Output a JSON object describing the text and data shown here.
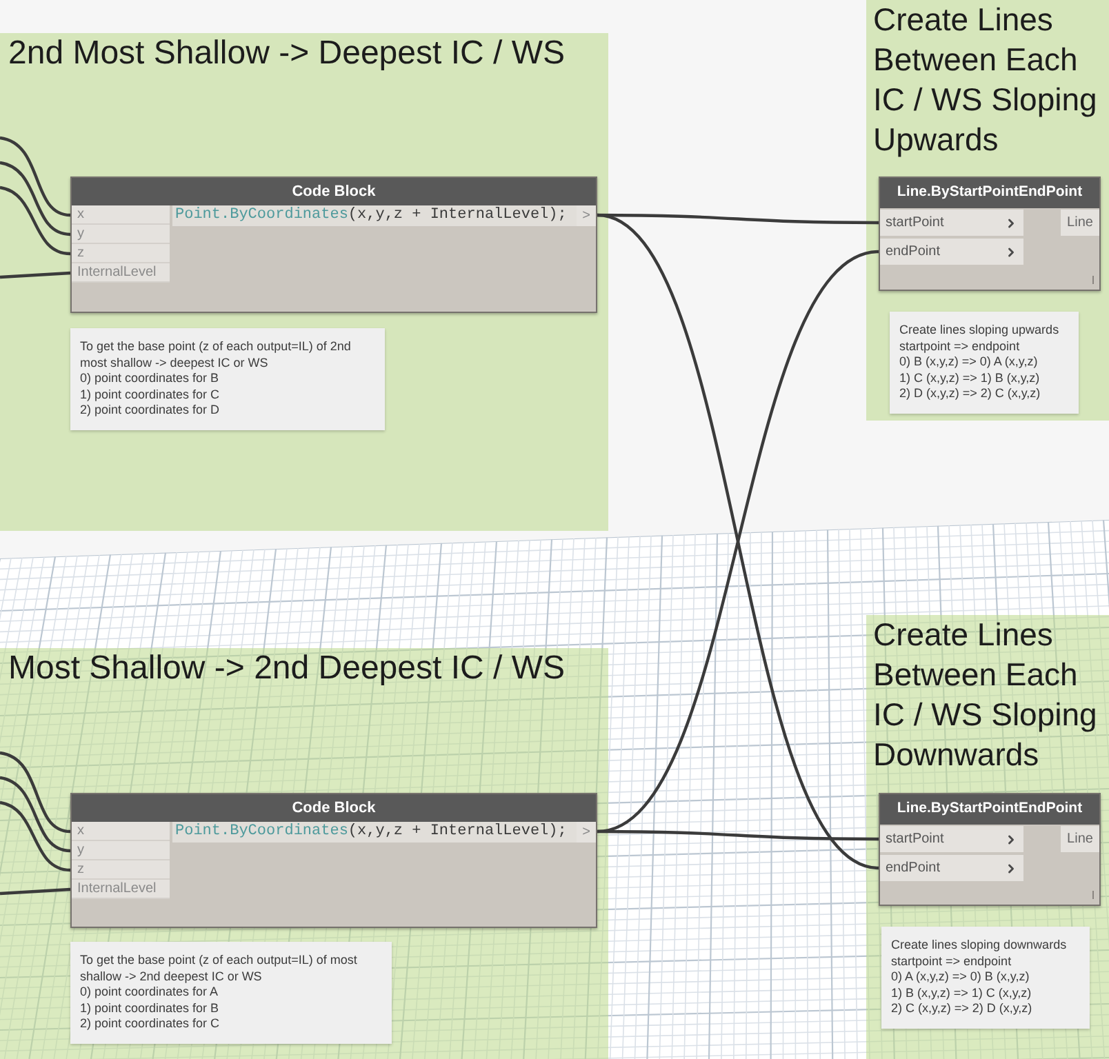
{
  "groups": [
    {
      "title": "2nd Most Shallow -> Deepest IC / WS",
      "node": {
        "kind": "code_block",
        "title": "Code Block",
        "inputs": [
          "x",
          "y",
          "z",
          "InternalLevel"
        ],
        "code": [
          {
            "kind": "function_call",
            "text": "Point.ByCoordinates"
          },
          {
            "kind": "plain",
            "text": "(x,y,z + InternalLevel);"
          }
        ],
        "outputs": [
          ">"
        ]
      },
      "note": [
        "To get the base point (z of each output=IL) of 2nd",
        "most shallow -> deepest IC or WS",
        "0) point coordinates for B",
        "1) point coordinates for C",
        "2) point coordinates for D"
      ]
    },
    {
      "title": "Create Lines Between Each IC / WS Sloping Upwards",
      "node": {
        "kind": "function",
        "title": "Line.ByStartPointEndPoint",
        "inputs": [
          "startPoint",
          "endPoint"
        ],
        "outputs": [
          "Line"
        ]
      },
      "note": [
        "Create lines sloping upwards",
        "startpoint => endpoint",
        "0) B (x,y,z) => 0) A (x,y,z)",
        "1) C (x,y,z) => 1) B (x,y,z)",
        "2) D (x,y,z) => 2) C (x,y,z)"
      ]
    },
    {
      "title": "Most Shallow -> 2nd Deepest IC / WS",
      "node": {
        "kind": "code_block",
        "title": "Code Block",
        "inputs": [
          "x",
          "y",
          "z",
          "InternalLevel"
        ],
        "code": [
          {
            "kind": "function_call",
            "text": "Point.ByCoordinates"
          },
          {
            "kind": "plain",
            "text": "(x,y,z + InternalLevel);"
          }
        ],
        "outputs": [
          ">"
        ]
      },
      "note": [
        "To get the base point (z of each output=IL) of most",
        "shallow -> 2nd deepest IC or WS",
        "0) point coordinates for A",
        "1) point coordinates for B",
        "2) point coordinates for C"
      ]
    },
    {
      "title": "Create Lines Between Each IC / WS Sloping Downwards",
      "node": {
        "kind": "function",
        "title": "Line.ByStartPointEndPoint",
        "inputs": [
          "startPoint",
          "endPoint"
        ],
        "outputs": [
          "Line"
        ]
      },
      "note": [
        "Create lines sloping downwards",
        "startpoint => endpoint",
        "0) A (x,y,z) => 0) B (x,y,z)",
        "1) B (x,y,z) => 1) C (x,y,z)",
        "2) C (x,y,z) => 2) D (x,y,z)"
      ]
    }
  ]
}
